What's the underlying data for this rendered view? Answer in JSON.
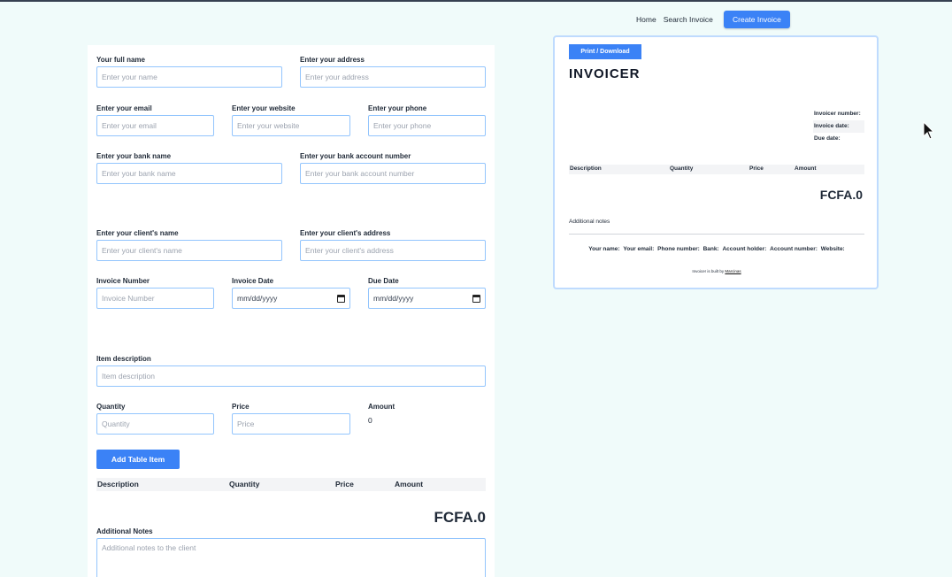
{
  "nav": {
    "home": "Home",
    "search": "Search Invoice",
    "create": "Create Invoice"
  },
  "form": {
    "full_name": {
      "label": "Your full name",
      "placeholder": "Enter your name"
    },
    "address": {
      "label": "Enter your address",
      "placeholder": "Enter your address"
    },
    "email": {
      "label": "Enter your email",
      "placeholder": "Enter your email"
    },
    "website": {
      "label": "Enter your website",
      "placeholder": "Enter your website"
    },
    "phone": {
      "label": "Enter your phone",
      "placeholder": "Enter your phone"
    },
    "bank_name": {
      "label": "Enter your bank name",
      "placeholder": "Enter your bank name"
    },
    "bank_account": {
      "label": "Enter your bank account number",
      "placeholder": "Enter your bank account number"
    },
    "client_name": {
      "label": "Enter your client's name",
      "placeholder": "Enter your client's name"
    },
    "client_address": {
      "label": "Enter your client's address",
      "placeholder": "Enter your client's address"
    },
    "invoice_number": {
      "label": "Invoice Number",
      "placeholder": "Invoice Number"
    },
    "invoice_date": {
      "label": "Invoice Date",
      "value": "mm/dd/yyyy"
    },
    "due_date": {
      "label": "Due Date",
      "value": "mm/dd/yyyy"
    },
    "item_description": {
      "label": "Item description",
      "placeholder": "Item description"
    },
    "quantity": {
      "label": "Quantity",
      "placeholder": "Quantity"
    },
    "price": {
      "label": "Price",
      "placeholder": "Price"
    },
    "amount": {
      "label": "Amount",
      "value": "0"
    },
    "add_button": "Add Table Item",
    "table_headers": [
      "Description",
      "Quantity",
      "Price",
      "Amount"
    ],
    "total": "FCFA.0",
    "notes": {
      "label": "Additional Notes",
      "placeholder": "Additional notes to the client"
    }
  },
  "preview": {
    "print_button": "Print / Download",
    "title": "INVOICER",
    "meta": [
      "Invoicer number:",
      "Invoice date:",
      "Due date:"
    ],
    "table_headers": [
      "Description",
      "Quantity",
      "Price",
      "Amount"
    ],
    "total": "FCFA.0",
    "notes_label": "Additional notes",
    "footer": [
      "Your name:",
      "Your email:",
      "Phone number:",
      "Bank:",
      "Account holder:",
      "Account number:",
      "Website:"
    ],
    "built_by_text": "Invoicer is built by",
    "built_by_link": "Marcinas"
  }
}
